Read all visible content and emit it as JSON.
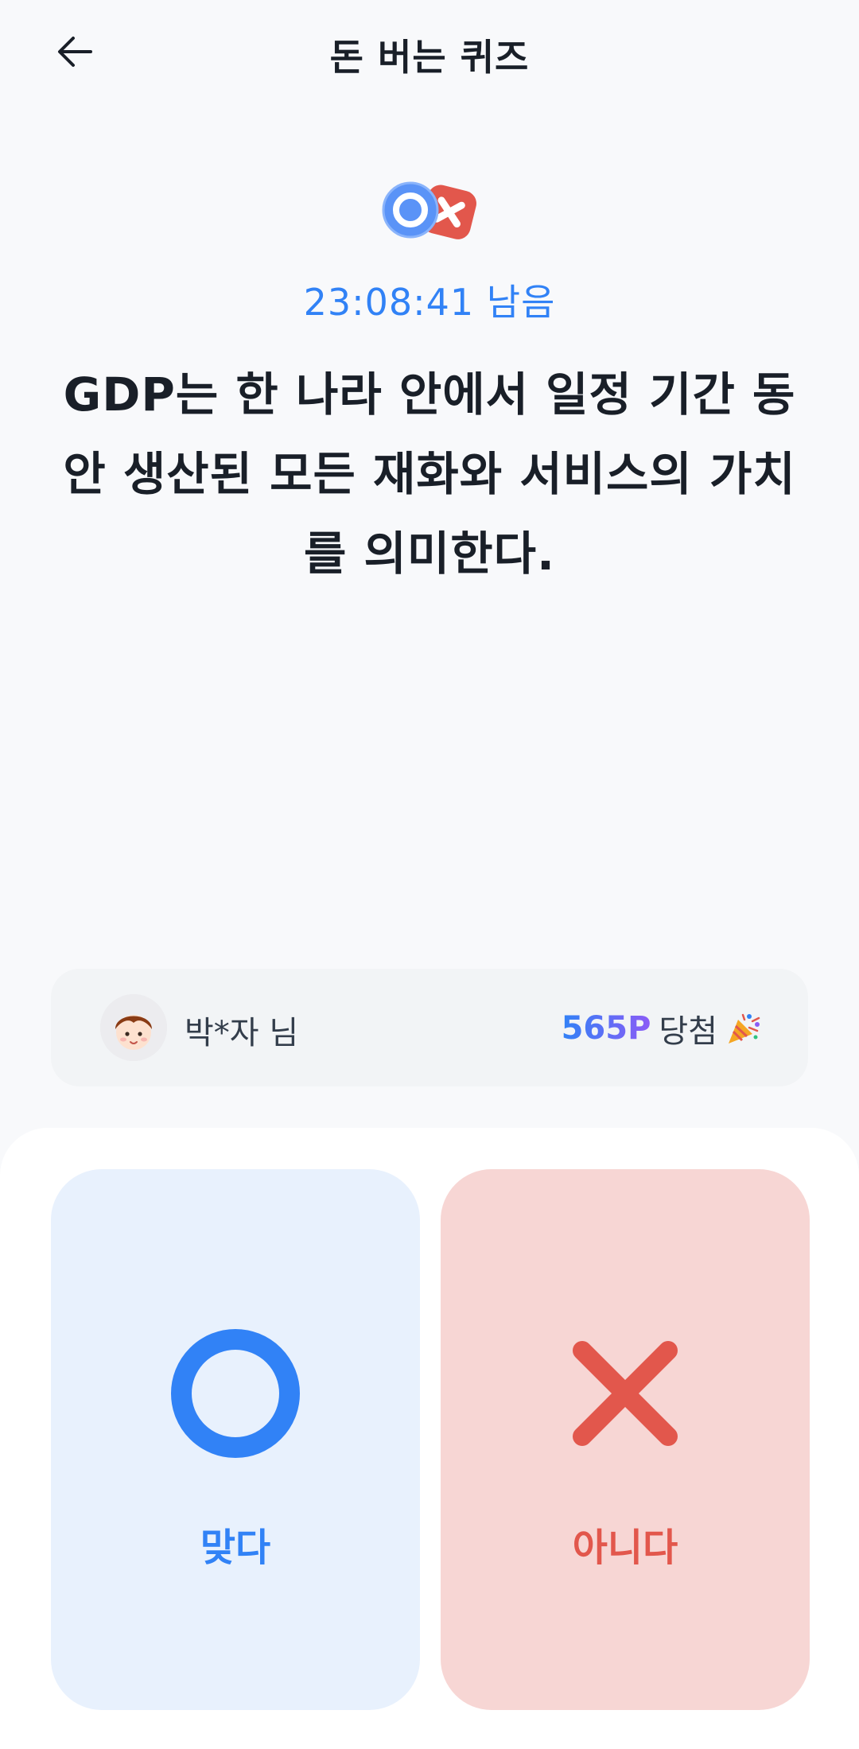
{
  "header": {
    "title": "돈 버는 퀴즈",
    "back_icon": "arrow-left-icon"
  },
  "quiz": {
    "badge_icon": "ox-quiz-icon",
    "timer": "23:08:41 남음",
    "question": "GDP는 한 나라 안에서 일정 기간 동안 생산된 모든 재화와 서비스의 가치를 의미한다."
  },
  "winner": {
    "name": "박*자 님",
    "points": "565P",
    "prize_suffix": "당첨",
    "avatar_icon": "user-avatar-icon",
    "celebrate_icon": "party-popper-icon"
  },
  "answers": {
    "yes_label": "맞다",
    "no_label": "아니다"
  },
  "colors": {
    "accent_blue": "#3182f6",
    "accent_red": "#e2574c",
    "yes_bg": "#e8f1fd",
    "no_bg": "#f7d6d4"
  }
}
